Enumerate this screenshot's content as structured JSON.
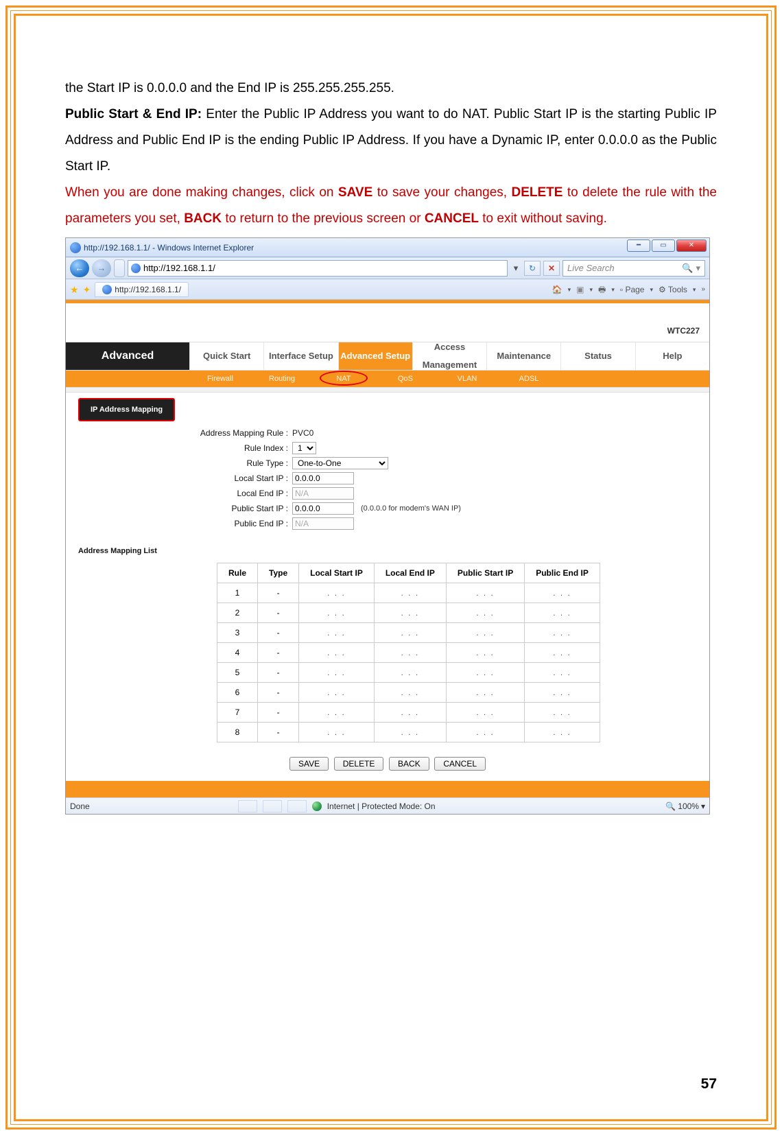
{
  "doc": {
    "p1": "the Start IP is 0.0.0.0 and the End IP is 255.255.255.255.",
    "p2_bold": "Public Start & End IP:",
    "p2_rest": " Enter the Public IP Address you want to do NAT. Public Start IP is the starting Public IP Address and Public End IP is the ending Public IP Address. If you have a Dynamic IP, enter 0.0.0.0 as the Public Start IP.",
    "p3_a": "When you are done making changes, click on ",
    "p3_b1": "SAVE",
    "p3_b": " to save your changes, ",
    "p3_b2": "DELETE",
    "p3_c": " to delete the rule with the parameters you set, ",
    "p3_b3": "BACK",
    "p3_d": " to return to the previous screen or ",
    "p3_b4": "CANCEL",
    "p3_e": " to exit without saving.",
    "page_num": "57"
  },
  "browser": {
    "title": "http://192.168.1.1/ - Windows Internet Explorer",
    "url": "http://192.168.1.1/",
    "tab_title": "http://192.168.1.1/",
    "search_placeholder": "Live Search",
    "toolbar_page": "Page",
    "toolbar_tools": "Tools",
    "status_done": "Done",
    "status_mode": "Internet | Protected Mode: On",
    "zoom": "100%"
  },
  "router": {
    "model": "WTC227",
    "nav_section": "Advanced",
    "nav": [
      "Quick Start",
      "Interface Setup",
      "Advanced Setup",
      "Access Management",
      "Maintenance",
      "Status",
      "Help"
    ],
    "subnav": [
      "Firewall",
      "Routing",
      "NAT",
      "QoS",
      "VLAN",
      "ADSL"
    ],
    "section_title": "IP Address Mapping",
    "form": {
      "rule_label": "Address Mapping Rule :",
      "rule_value": "PVC0",
      "index_label": "Rule Index :",
      "index_value": "1",
      "type_label": "Rule Type :",
      "type_value": "One-to-One",
      "lstart_label": "Local Start IP :",
      "lstart_value": "0.0.0.0",
      "lend_label": "Local End IP :",
      "lend_value": "N/A",
      "pstart_label": "Public Start IP :",
      "pstart_value": "0.0.0.0",
      "pstart_hint": "(0.0.0.0 for modem's WAN IP)",
      "pend_label": "Public End IP :",
      "pend_value": "N/A"
    },
    "list_title": "Address Mapping List",
    "table": {
      "headers": [
        "Rule",
        "Type",
        "Local Start IP",
        "Local End IP",
        "Public Start IP",
        "Public End IP"
      ],
      "rows": [
        {
          "rule": "1",
          "type": "-",
          "a": ". . .",
          "b": ". . .",
          "c": ". . .",
          "d": ". . ."
        },
        {
          "rule": "2",
          "type": "-",
          "a": ". . .",
          "b": ". . .",
          "c": ". . .",
          "d": ". . ."
        },
        {
          "rule": "3",
          "type": "-",
          "a": ". . .",
          "b": ". . .",
          "c": ". . .",
          "d": ". . ."
        },
        {
          "rule": "4",
          "type": "-",
          "a": ". . .",
          "b": ". . .",
          "c": ". . .",
          "d": ". . ."
        },
        {
          "rule": "5",
          "type": "-",
          "a": ". . .",
          "b": ". . .",
          "c": ". . .",
          "d": ". . ."
        },
        {
          "rule": "6",
          "type": "-",
          "a": ". . .",
          "b": ". . .",
          "c": ". . .",
          "d": ". . ."
        },
        {
          "rule": "7",
          "type": "-",
          "a": ". . .",
          "b": ". . .",
          "c": ". . .",
          "d": ". . ."
        },
        {
          "rule": "8",
          "type": "-",
          "a": ". . .",
          "b": ". . .",
          "c": ". . .",
          "d": ". . ."
        }
      ]
    },
    "buttons": {
      "save": "SAVE",
      "delete": "DELETE",
      "back": "BACK",
      "cancel": "CANCEL"
    }
  }
}
